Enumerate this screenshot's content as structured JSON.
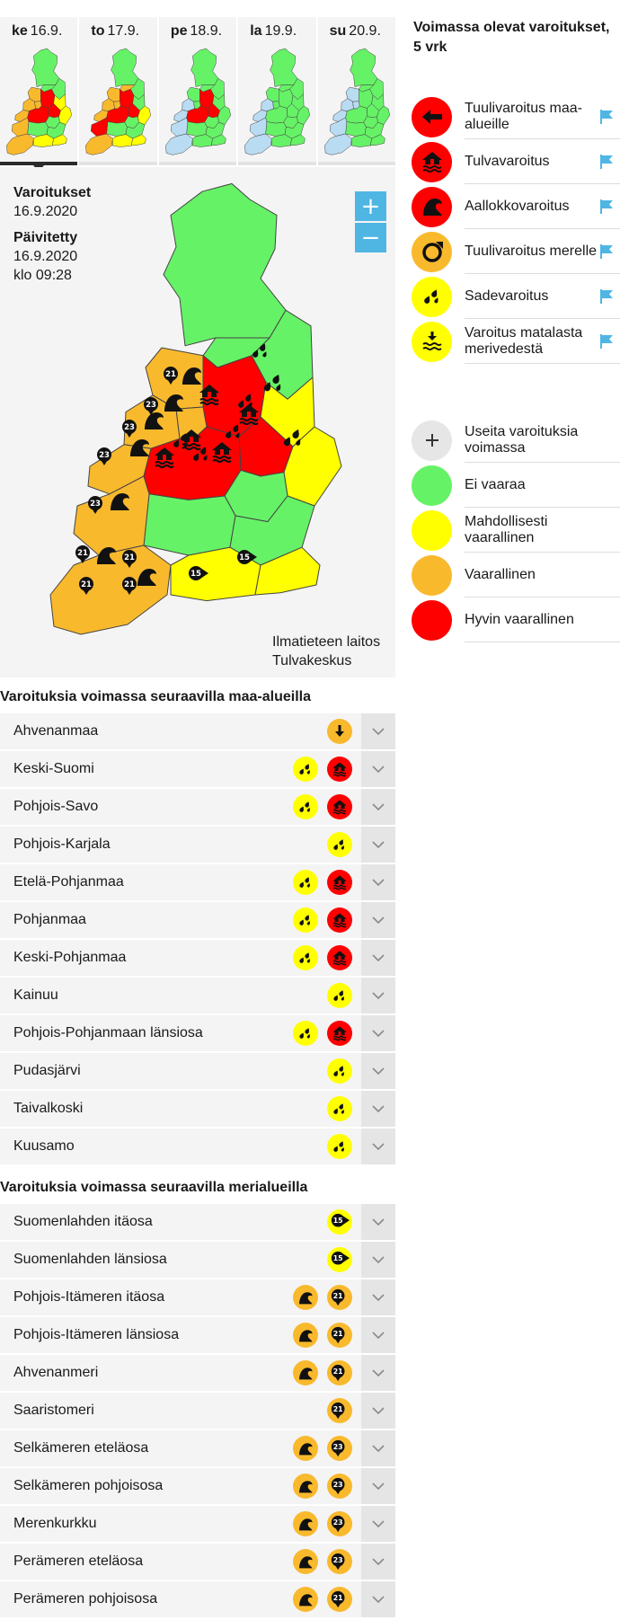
{
  "colors": {
    "red": "#ff0000",
    "orange": "#f9b92d",
    "yellow": "#ffff00",
    "green": "#66f266",
    "light_blue": "#b9dcf2",
    "accent_blue": "#4fb6e4",
    "row_bg": "#f4f4f4"
  },
  "days": [
    {
      "weekday": "ke",
      "date": "16.9.",
      "active": true
    },
    {
      "weekday": "to",
      "date": "17.9.",
      "active": false
    },
    {
      "weekday": "pe",
      "date": "18.9.",
      "active": false
    },
    {
      "weekday": "la",
      "date": "19.9.",
      "active": false
    },
    {
      "weekday": "su",
      "date": "20.9.",
      "active": false
    }
  ],
  "map": {
    "warnings_label": "Varoitukset",
    "warnings_date": "16.9.2020",
    "updated_label": "Päivitetty",
    "updated_date": "16.9.2020",
    "updated_time": "klo 09:28",
    "zoom_in": "+",
    "zoom_out": "−",
    "credit_1": "Ilmatieteen laitos",
    "credit_2": "Tulvakeskus",
    "markers": [
      "21",
      "23",
      "23",
      "23",
      "23",
      "21",
      "21",
      "21",
      "21",
      "15",
      "15"
    ]
  },
  "legend": {
    "title": "Voimassa olevat varoitukset, 5 vrk",
    "warning_types": [
      {
        "label": "Tuulivaroitus maa-alueille",
        "icon": "wind-arrow-icon"
      },
      {
        "label": "Tulvavaroitus",
        "icon": "flood-house-icon"
      },
      {
        "label": "Aallokkovaroitus",
        "icon": "wave-icon"
      },
      {
        "label": "Tuulivaroitus merelle",
        "icon": "sea-wind-ring-icon"
      },
      {
        "label": "Sadevaroitus",
        "icon": "rain-drops-icon"
      },
      {
        "label": "Varoitus matalasta merivedestä",
        "icon": "low-sea-water-icon"
      }
    ],
    "levels": [
      {
        "label": "Useita varoituksia voimassa",
        "icon": "plus-icon"
      },
      {
        "label": "Ei vaaraa"
      },
      {
        "label": "Mahdollisesti vaarallinen"
      },
      {
        "label": "Vaarallinen"
      },
      {
        "label": "Hyvin vaarallinen"
      }
    ]
  },
  "land": {
    "heading": "Varoituksia voimassa seuraavilla maa-alueilla",
    "rows": [
      {
        "name": "Ahvenanmaa",
        "icons": [
          "lowsea-orange"
        ]
      },
      {
        "name": "Keski-Suomi",
        "icons": [
          "flood-red",
          "rain-yellow"
        ]
      },
      {
        "name": "Pohjois-Savo",
        "icons": [
          "flood-red",
          "rain-yellow"
        ]
      },
      {
        "name": "Pohjois-Karjala",
        "icons": [
          "rain-yellow"
        ]
      },
      {
        "name": "Etelä-Pohjanmaa",
        "icons": [
          "flood-red",
          "rain-yellow"
        ]
      },
      {
        "name": "Pohjanmaa",
        "icons": [
          "flood-red",
          "rain-yellow"
        ]
      },
      {
        "name": "Keski-Pohjanmaa",
        "icons": [
          "flood-red",
          "rain-yellow"
        ]
      },
      {
        "name": "Kainuu",
        "icons": [
          "rain-yellow"
        ]
      },
      {
        "name": "Pohjois-Pohjanmaan länsiosa",
        "icons": [
          "flood-red",
          "rain-yellow"
        ]
      },
      {
        "name": "Pudasjärvi",
        "icons": [
          "rain-yellow"
        ]
      },
      {
        "name": "Taivalkoski",
        "icons": [
          "rain-yellow"
        ]
      },
      {
        "name": "Kuusamo",
        "icons": [
          "rain-yellow"
        ]
      }
    ]
  },
  "sea": {
    "heading": "Varoituksia voimassa seuraavilla merialueilla",
    "rows": [
      {
        "name": "Suomenlahden itäosa",
        "icons": [
          "wind15-yellow"
        ]
      },
      {
        "name": "Suomenlahden länsiosa",
        "icons": [
          "wind15-yellow"
        ]
      },
      {
        "name": "Pohjois-Itämeren itäosa",
        "icons": [
          "wind21-orange",
          "wave-orange"
        ]
      },
      {
        "name": "Pohjois-Itämeren länsiosa",
        "icons": [
          "wind21-orange",
          "wave-orange"
        ]
      },
      {
        "name": "Ahvenanmeri",
        "icons": [
          "wind21-orange",
          "wave-orange"
        ]
      },
      {
        "name": "Saaristomeri",
        "icons": [
          "wind21-orange"
        ]
      },
      {
        "name": "Selkämeren eteläosa",
        "icons": [
          "wind23-orange",
          "wave-orange"
        ]
      },
      {
        "name": "Selkämeren pohjoisosa",
        "icons": [
          "wind23-orange",
          "wave-orange"
        ]
      },
      {
        "name": "Merenkurkku",
        "icons": [
          "wind23-orange",
          "wave-orange"
        ]
      },
      {
        "name": "Perämeren eteläosa",
        "icons": [
          "wind23-orange",
          "wave-orange"
        ]
      },
      {
        "name": "Perämeren pohjoisosa",
        "icons": [
          "wind21-orange",
          "wave-orange"
        ]
      }
    ]
  }
}
